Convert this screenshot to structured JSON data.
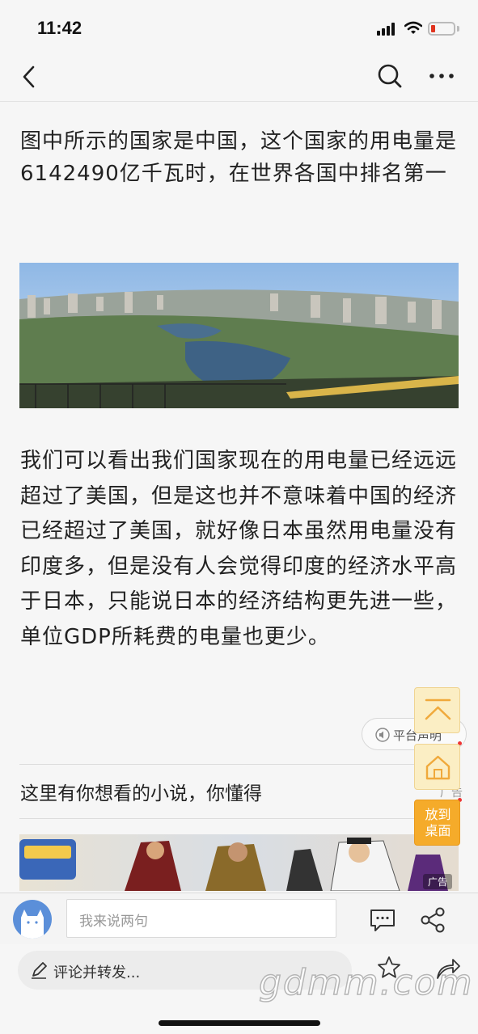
{
  "status_bar": {
    "time": "11:42"
  },
  "nav_bar": {
    "back_icon": "chevron-left-icon",
    "search_icon": "search-icon",
    "more_icon": "more-dots-icon"
  },
  "article": {
    "paragraph_1": "图中所示的国家是中国，这个国家的用电量是6142490亿千瓦时，在世界各国中排名第一",
    "paragraph_2": "我们可以看出我们国家现在的用电量已经远远超过了美国，但是这也并不意味着中国的经济已经超过了美国，就好像日本虽然用电量没有印度多，但是没有人会觉得印度的经济水平高于日本，只能说日本的经济结构更先进一些，单位GDP所耗费的电量也更少。",
    "platform_statement": "平台声明"
  },
  "promo": {
    "text": "这里有你想看的小说，你懂得",
    "ad_label": "广告"
  },
  "banner": {
    "ad_tag": "广告"
  },
  "float_buttons": {
    "desktop_line1": "放到",
    "desktop_line2": "桌面"
  },
  "comment_bar": {
    "placeholder": "我来说两句"
  },
  "forward_bar": {
    "label": "评论并转发...",
    "watermark": "gdmm.com"
  },
  "colors": {
    "accent_orange": "#f5ab2a",
    "float_bg": "#fbeec4",
    "battery_low": "#e0341f"
  }
}
